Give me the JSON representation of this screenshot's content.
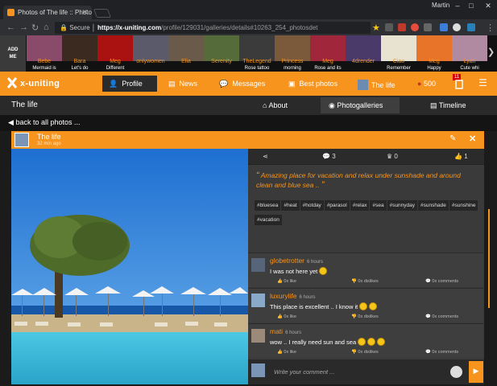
{
  "browser": {
    "tab_title": "Photos of The life :: Photo",
    "tab_close": "✕",
    "user": "Martin",
    "secure_label": "Secure",
    "url_host": "https://x-uniting.com",
    "url_path": "/profile/129031/galleries/details#10263_254_photosdet"
  },
  "friends": {
    "add_me": [
      "ADD",
      "ME"
    ],
    "items": [
      {
        "name": "Bebe",
        "status": "Mermaid is"
      },
      {
        "name": "Bara",
        "status": "Let's do"
      },
      {
        "name": "Meg",
        "status": "Different"
      },
      {
        "name": "onlywomen",
        "status": ""
      },
      {
        "name": "Elia",
        "status": ""
      },
      {
        "name": "Serenity",
        "status": ""
      },
      {
        "name": "TheLegend",
        "status": "Rose tattoo"
      },
      {
        "name": "Princess",
        "status": "morning"
      },
      {
        "name": "Meg",
        "status": "Rose and its"
      },
      {
        "name": "4drender",
        "status": ""
      },
      {
        "name": "Ciao",
        "status": "Remember"
      },
      {
        "name": "Meg",
        "status": "Happy"
      },
      {
        "name": "Lyah",
        "status": "Cute whi"
      }
    ],
    "more_icon": "chevron-right-icon"
  },
  "nav": {
    "logo": "x-uniting",
    "profile": "Profile",
    "news": "News",
    "messages": "Messages",
    "best_photos": "Best photos",
    "the_life": "The life",
    "coins": "500",
    "notif_badge": "11"
  },
  "subbar": {
    "title": "The life",
    "about": "About",
    "photogalleries": "Photogalleries",
    "timeline": "Timeline"
  },
  "back": {
    "label": "back to all photos ..."
  },
  "photo_header": {
    "title": "The life",
    "date": "32 min ago"
  },
  "stats": {
    "comments": "3",
    "crowns": "0",
    "likes": "1"
  },
  "description": "Amazing place for vacation and relax under sunshade and around clean and blue sea ..",
  "tags": [
    "#bluesea",
    "#heat",
    "#hotday",
    "#parasol",
    "#relax",
    "#sea",
    "#sunnyday",
    "#sunshade",
    "#sunshine",
    "#vacation"
  ],
  "comments": [
    {
      "author": "globetrotter",
      "time": "6 hours",
      "text": "I was not here yet",
      "emojis": 1,
      "like": "0x like",
      "dislike": "0x dislikes",
      "comments": "0x comments"
    },
    {
      "author": "luxurylife",
      "time": "6 hours",
      "text": "This place is excellent .. I know it",
      "emojis": 2,
      "like": "0x like",
      "dislike": "0x dislikes",
      "comments": "0x comments"
    },
    {
      "author": "mati",
      "time": "6 hours",
      "text": "wow .. I really need sun and sea",
      "emojis": 3,
      "like": "0x like",
      "dislike": "0x dislikes",
      "comments": "0x comments"
    }
  ],
  "write": {
    "placeholder": "Write your comment ..."
  },
  "colors": {
    "accent": "#f7941d",
    "dark": "#1f1f1f"
  }
}
